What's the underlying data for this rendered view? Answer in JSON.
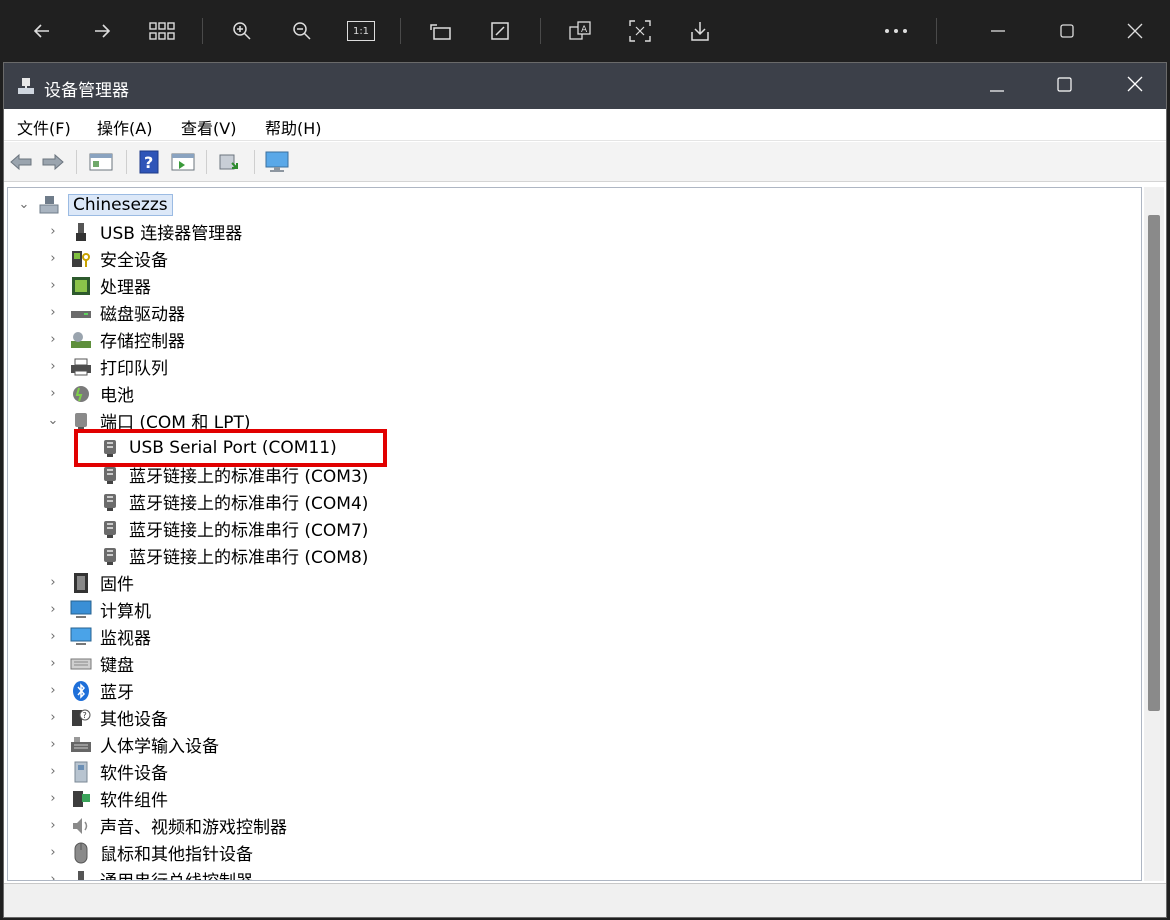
{
  "window": {
    "title": "设备管理器",
    "minimize_icon": "minimize-icon",
    "maximize_icon": "maximize-icon",
    "close_icon": "close-icon"
  },
  "viewer_toolbar": {
    "icons": [
      "back-arrow-icon",
      "forward-arrow-icon",
      "grid-icon",
      "zoom-in-icon",
      "zoom-out-icon",
      "actual-size-icon",
      "rotate-icon",
      "edit-icon",
      "translate-icon",
      "ocr-icon",
      "save-icon",
      "more-icon",
      "minimize-icon",
      "maximize-icon",
      "close-icon"
    ],
    "actual_size_label": "1:1"
  },
  "menu": [
    "文件(F)",
    "操作(A)",
    "查看(V)",
    "帮助(H)"
  ],
  "toolbar": {
    "icons": [
      "back-icon",
      "forward-icon",
      "properties-icon",
      "help-icon",
      "update-driver-icon",
      "scan-hardware-icon",
      "monitor-icon"
    ]
  },
  "tree": {
    "root": "Chinesezzs",
    "categories": [
      {
        "label": "USB 连接器管理器",
        "icon": "usb-connector-icon",
        "expanded": false
      },
      {
        "label": "安全设备",
        "icon": "security-device-icon",
        "expanded": false
      },
      {
        "label": "处理器",
        "icon": "processor-icon",
        "expanded": false
      },
      {
        "label": "磁盘驱动器",
        "icon": "disk-drive-icon",
        "expanded": false
      },
      {
        "label": "存储控制器",
        "icon": "storage-controller-icon",
        "expanded": false
      },
      {
        "label": "打印队列",
        "icon": "printer-icon",
        "expanded": false
      },
      {
        "label": "电池",
        "icon": "battery-icon",
        "expanded": false
      },
      {
        "label": "端口 (COM 和 LPT)",
        "icon": "port-icon",
        "expanded": true,
        "children": [
          {
            "label": "USB Serial Port (COM11)",
            "icon": "serial-port-icon",
            "highlighted": true
          },
          {
            "label": "蓝牙链接上的标准串行 (COM3)",
            "icon": "serial-port-icon"
          },
          {
            "label": "蓝牙链接上的标准串行 (COM4)",
            "icon": "serial-port-icon"
          },
          {
            "label": "蓝牙链接上的标准串行 (COM7)",
            "icon": "serial-port-icon"
          },
          {
            "label": "蓝牙链接上的标准串行 (COM8)",
            "icon": "serial-port-icon"
          }
        ]
      },
      {
        "label": "固件",
        "icon": "firmware-icon",
        "expanded": false
      },
      {
        "label": "计算机",
        "icon": "computer-icon",
        "expanded": false
      },
      {
        "label": "监视器",
        "icon": "monitor-icon",
        "expanded": false
      },
      {
        "label": "键盘",
        "icon": "keyboard-icon",
        "expanded": false
      },
      {
        "label": "蓝牙",
        "icon": "bluetooth-icon",
        "expanded": false
      },
      {
        "label": "其他设备",
        "icon": "other-devices-icon",
        "expanded": false
      },
      {
        "label": "人体学输入设备",
        "icon": "hid-icon",
        "expanded": false
      },
      {
        "label": "软件设备",
        "icon": "software-device-icon",
        "expanded": false
      },
      {
        "label": "软件组件",
        "icon": "software-component-icon",
        "expanded": false
      },
      {
        "label": "声音、视频和游戏控制器",
        "icon": "audio-icon",
        "expanded": false
      },
      {
        "label": "鼠标和其他指针设备",
        "icon": "mouse-icon",
        "expanded": false
      },
      {
        "label": "通用串行总线控制器",
        "icon": "usb-controller-icon",
        "expanded": false
      }
    ]
  },
  "colors": {
    "titlebar": "#3c4049",
    "highlight_box": "#e10000",
    "root_selection": "#dce8f8"
  }
}
